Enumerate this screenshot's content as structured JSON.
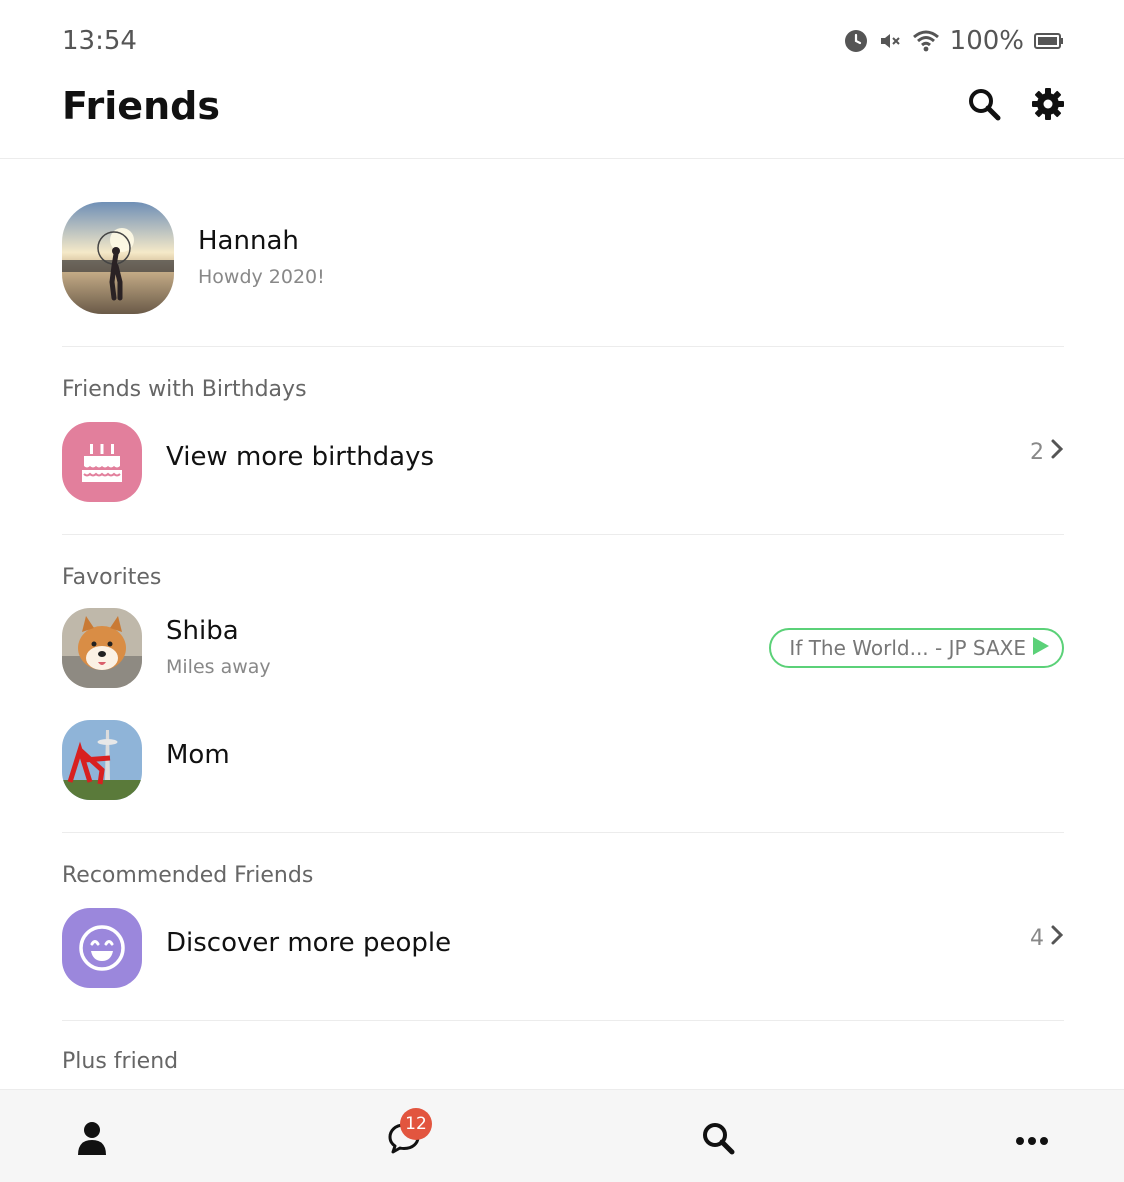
{
  "status_bar": {
    "time": "13:54",
    "battery": "100%",
    "icons": [
      "alarm-icon",
      "mute-icon",
      "wifi-icon",
      "battery-icon"
    ]
  },
  "header": {
    "title": "Friends",
    "icons": [
      "search-icon",
      "gear-icon"
    ]
  },
  "profile": {
    "name": "Hannah",
    "status": "Howdy 2020!"
  },
  "birthdays": {
    "section_title": "Friends with Birthdays",
    "label": "View more birthdays",
    "count": "2",
    "icon": "cake-icon",
    "icon_color": "#e27f9c"
  },
  "favorites": {
    "section_title": "Favorites",
    "items": [
      {
        "name": "Shiba",
        "status": "Miles away",
        "music": "If The World... - JP SAXE"
      },
      {
        "name": "Mom"
      }
    ],
    "music_accent": "#5bd178"
  },
  "recommended": {
    "section_title": "Recommended Friends",
    "label": "Discover more people",
    "count": "4",
    "icon": "smile-icon",
    "icon_color": "#9b87dc"
  },
  "plus_friend": {
    "section_title": "Plus friend"
  },
  "bottom_nav": {
    "items": [
      "friends-icon",
      "chat-icon",
      "search-icon",
      "more-icon"
    ],
    "chat_badge": "12",
    "badge_color": "#e2553f"
  }
}
